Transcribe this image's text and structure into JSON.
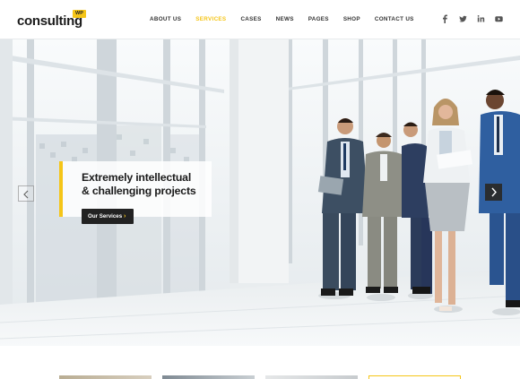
{
  "logo": {
    "text": "consulting",
    "badge": "WP"
  },
  "nav": {
    "items": [
      {
        "label": "ABOUT US"
      },
      {
        "label": "SERVICES"
      },
      {
        "label": "CASES"
      },
      {
        "label": "NEWS"
      },
      {
        "label": "PAGES"
      },
      {
        "label": "SHOP"
      },
      {
        "label": "CONTACT US"
      }
    ],
    "active_index": 1
  },
  "socials": [
    "facebook-icon",
    "twitter-icon",
    "linkedin-icon",
    "youtube-icon"
  ],
  "slide": {
    "title_line1": "Extremely intellectual",
    "title_line2": "& challenging projects",
    "cta_label": "Our Services"
  },
  "colors": {
    "accent": "#f5c518",
    "dark": "#222222",
    "text": "#1b1b1b"
  }
}
